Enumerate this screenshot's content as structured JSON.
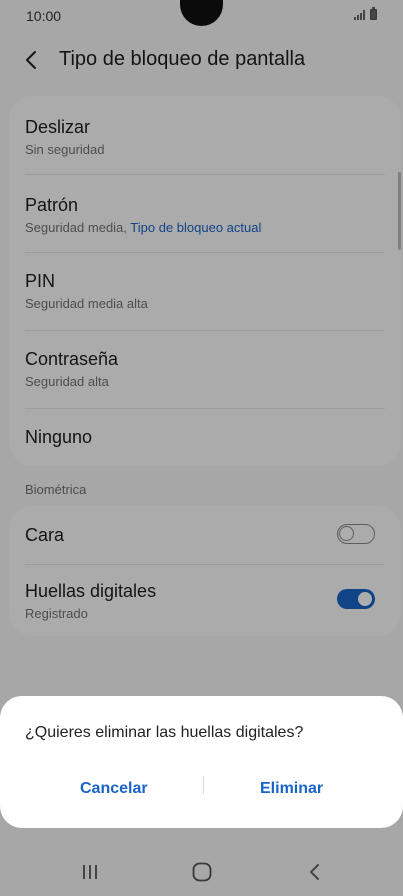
{
  "status_bar": {
    "time": "10:00",
    "signal_icon": "signal-icon",
    "battery_icon": "battery-icon"
  },
  "header": {
    "back_icon": "chevron-left-icon",
    "title": "Tipo de bloqueo de pantalla"
  },
  "options": [
    {
      "title": "Deslizar",
      "subtitle": "Sin seguridad"
    },
    {
      "title": "Patrón",
      "subtitle": "Seguridad media,",
      "subtitle_accent": "Tipo de bloqueo actual"
    },
    {
      "title": "PIN",
      "subtitle": "Seguridad media alta"
    },
    {
      "title": "Contraseña",
      "subtitle": "Seguridad alta"
    },
    {
      "title": "Ninguno"
    }
  ],
  "biometrics": {
    "section_title": "Biométrica",
    "items": [
      {
        "title": "Cara",
        "toggle": "off"
      },
      {
        "title": "Huellas digitales",
        "subtitle": "Registrado",
        "toggle": "on"
      }
    ]
  },
  "dialog": {
    "message": "¿Quieres eliminar las huellas digitales?",
    "cancel_label": "Cancelar",
    "confirm_label": "Eliminar"
  },
  "nav_bar": {
    "recents_icon": "recents-icon",
    "home_icon": "home-icon",
    "back_icon": "back-icon"
  },
  "colors": {
    "accent": "#1a64c8",
    "dim_overlay": "rgba(0,0,0,0.32)"
  }
}
